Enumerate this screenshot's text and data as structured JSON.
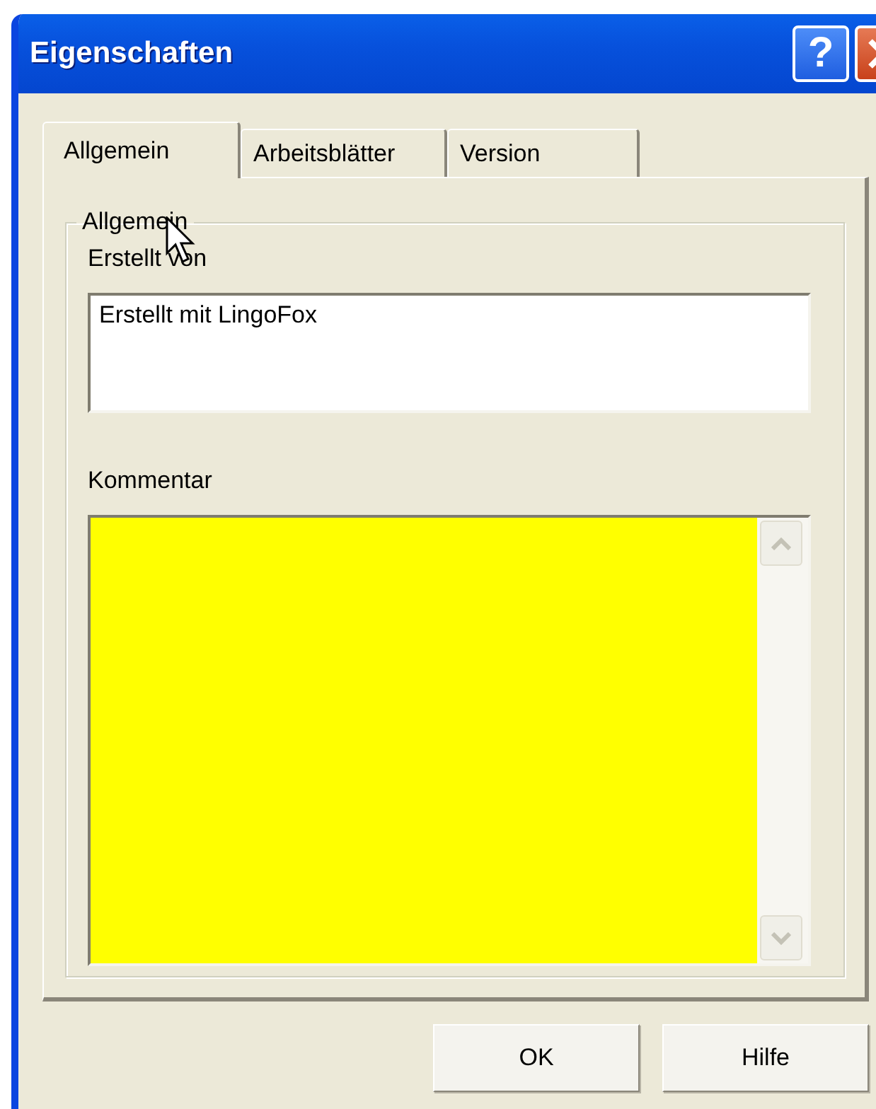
{
  "window": {
    "title": "Eigenschaften",
    "help_label": "?"
  },
  "tabs": [
    {
      "label": "Allgemein",
      "selected": true
    },
    {
      "label": "Arbeitsblätter",
      "selected": false
    },
    {
      "label": "Version",
      "selected": false
    }
  ],
  "group": {
    "label": "Allgemein",
    "fields": [
      {
        "kind": "text",
        "label": "Erstellt von",
        "value": "Erstellt mit LingoFox"
      },
      {
        "kind": "memo",
        "label": "Kommentar"
      }
    ]
  },
  "buttons": [
    {
      "label": "OK"
    },
    {
      "label": "Hilfe"
    }
  ]
}
